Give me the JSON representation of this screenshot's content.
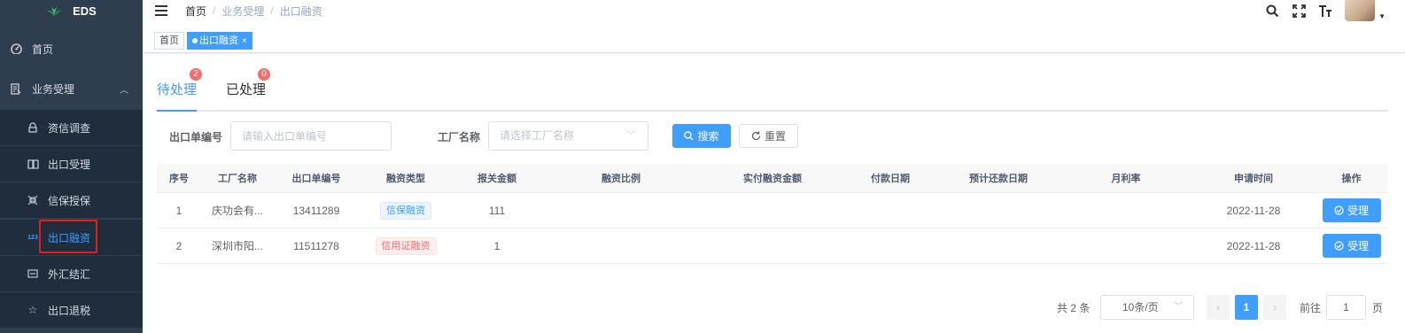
{
  "sidebar": {
    "logo_text": "EDS",
    "home": "首页",
    "group": "业务受理",
    "items": [
      {
        "label": "资信调查",
        "icon": "lock-icon"
      },
      {
        "label": "出口受理",
        "icon": "book-icon"
      },
      {
        "label": "信保授保",
        "icon": "shrink-icon"
      },
      {
        "label": "出口融资",
        "icon": "number-icon"
      },
      {
        "label": "外汇结汇",
        "icon": "exchange-icon"
      },
      {
        "label": "出口退税",
        "icon": "star-icon"
      }
    ]
  },
  "header": {
    "breadcrumb": [
      "首页",
      "业务受理",
      "出口融资"
    ]
  },
  "tags_view": {
    "home": "首页",
    "active": "出口融资"
  },
  "tabs": [
    {
      "label": "待处理",
      "badge": "2"
    },
    {
      "label": "已处理",
      "badge": "0"
    }
  ],
  "search": {
    "export_no_label": "出口单编号",
    "export_no_placeholder": "请输入出口单编号",
    "factory_label": "工厂名称",
    "factory_placeholder": "请选择工厂名称",
    "search_btn": "搜索",
    "reset_btn": "重置"
  },
  "table": {
    "headers": [
      "序号",
      "工厂名称",
      "出口单编号",
      "融资类型",
      "报关金额",
      "融资比例",
      "实付融资金额",
      "付款日期",
      "预计还款日期",
      "月利率",
      "申请时间",
      "操作"
    ],
    "rows": [
      {
        "index": "1",
        "factory": "庆功会有...",
        "export_no": "13411289",
        "type": "信保融资",
        "amount": "111",
        "ratio": "",
        "paid": "",
        "pay_date": "",
        "repay_date": "",
        "rate": "",
        "apply_time": "2022-11-28",
        "action": "受理"
      },
      {
        "index": "2",
        "factory": "深圳市阳...",
        "export_no": "11511278",
        "type": "信用证融资",
        "amount": "1",
        "ratio": "",
        "paid": "",
        "pay_date": "",
        "repay_date": "",
        "rate": "",
        "apply_time": "2022-11-28",
        "action": "受理"
      }
    ]
  },
  "pagination": {
    "total": "共 2 条",
    "page_size": "10条/页",
    "current": "1",
    "goto_label": "前往",
    "goto_value": "1",
    "page_unit": "页"
  },
  "colors": {
    "sidebar_bg": "#2f3e4e",
    "submenu_bg": "#1f2d3d",
    "primary": "#409eff",
    "badge": "#f56c6c",
    "highlight_box": "#e02020"
  }
}
